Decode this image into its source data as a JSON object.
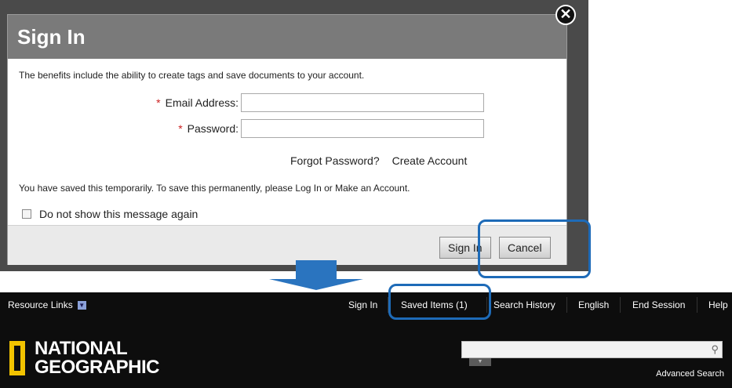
{
  "dialog": {
    "title": "Sign In",
    "intro": "The benefits include the ability to create tags and save documents to your account.",
    "required_mark": "*",
    "email_label": "Email Address:",
    "email_value": "",
    "password_label": "Password:",
    "password_value": "",
    "forgot_password": "Forgot Password?",
    "create_account": "Create Account",
    "saved_message": "You have saved this temporarily. To save this permanently, please Log In or Make an Account.",
    "checkbox_label": "Do not show this message again",
    "sign_in_button": "Sign In",
    "cancel_button": "Cancel",
    "close_glyph": "✕"
  },
  "navbar": {
    "resource_links": "Resource Links",
    "dropdown_glyph": "▼",
    "items": [
      "Sign In",
      "Saved Items (1)",
      "Search History",
      "English",
      "End Session",
      "Help"
    ],
    "logo_line1": "NATIONAL",
    "logo_line2": "GEOGRAPHIC",
    "search_placeholder": "",
    "search_icon_glyph": "⚲",
    "advanced_search": "Advanced Search"
  },
  "colors": {
    "highlight": "#1e6bb8",
    "logo_yellow": "#f2c300",
    "arrow": "#2a74bf"
  }
}
